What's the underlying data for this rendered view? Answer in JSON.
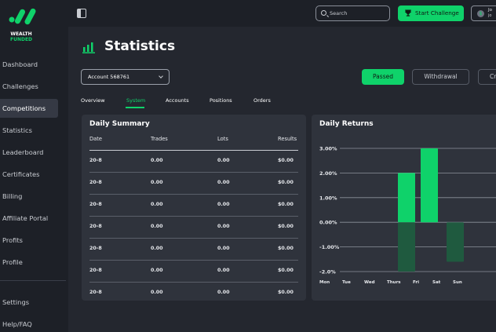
{
  "brand": {
    "line1": "WEALTH",
    "line2": "FUNDED",
    "accent": "#0fd26a"
  },
  "sidebar": {
    "items": [
      {
        "label": "Dashboard"
      },
      {
        "label": "Challenges"
      },
      {
        "label": "Competitions",
        "active": true
      },
      {
        "label": "Statistics"
      },
      {
        "label": "Leaderboard"
      },
      {
        "label": "Certificates"
      },
      {
        "label": "Billing"
      },
      {
        "label": "Affiliate Portal"
      },
      {
        "label": "Profits"
      },
      {
        "label": "Profile"
      }
    ],
    "bottom": [
      {
        "label": "Settings"
      },
      {
        "label": "Help/FAQ"
      }
    ]
  },
  "topbar": {
    "search_placeholder": "Search",
    "start_label": "Start Challenge",
    "user_name": "Jo",
    "user_sub": "jo",
    "avatar": "$"
  },
  "page": {
    "title": "Statistics"
  },
  "account": {
    "selected": "Account 568761"
  },
  "status_pills": [
    {
      "label": "Passed",
      "active": true
    },
    {
      "label": "Withdrawal"
    },
    {
      "label": "Cr"
    }
  ],
  "tabs": [
    {
      "label": "Overview"
    },
    {
      "label": "System",
      "active": true
    },
    {
      "label": "Accounts"
    },
    {
      "label": "Positions"
    },
    {
      "label": "Orders"
    }
  ],
  "summary": {
    "title": "Daily Summary",
    "columns": [
      "Date",
      "Trades",
      "Lots",
      "Results"
    ],
    "rows": [
      [
        "20-8",
        "0.00",
        "0.00",
        "$0.00"
      ],
      [
        "20-8",
        "0.00",
        "0.00",
        "$0.00"
      ],
      [
        "20-8",
        "0.00",
        "0.00",
        "$0.00"
      ],
      [
        "20-8",
        "0.00",
        "0.00",
        "$0.00"
      ],
      [
        "20-8",
        "0.00",
        "0.00",
        "$0.00"
      ],
      [
        "20-8",
        "0.00",
        "0.00",
        "$0.00"
      ],
      [
        "20-8",
        "0.00",
        "0.00",
        "$0.00"
      ]
    ]
  },
  "chart_data": {
    "type": "bar",
    "title": "Daily Returns",
    "categories": [
      "Mon",
      "Tue",
      "Wed",
      "Thurs",
      "Fri",
      "Sat",
      "Sun"
    ],
    "y_ticks": [
      "3.00%",
      "2.00%",
      "1.00%",
      "0.00%",
      "-1.00%",
      "-2.0%"
    ],
    "ylim": [
      -2,
      3
    ],
    "series": [
      {
        "values": [
          0,
          0,
          2.0,
          3.0,
          0,
          0,
          0
        ],
        "color": "#0fd26a"
      },
      {
        "values": [
          0,
          0,
          -2.0,
          0,
          -1.6,
          0,
          0
        ],
        "color": "#1f5a3f"
      }
    ],
    "grid": true,
    "legend": false
  }
}
